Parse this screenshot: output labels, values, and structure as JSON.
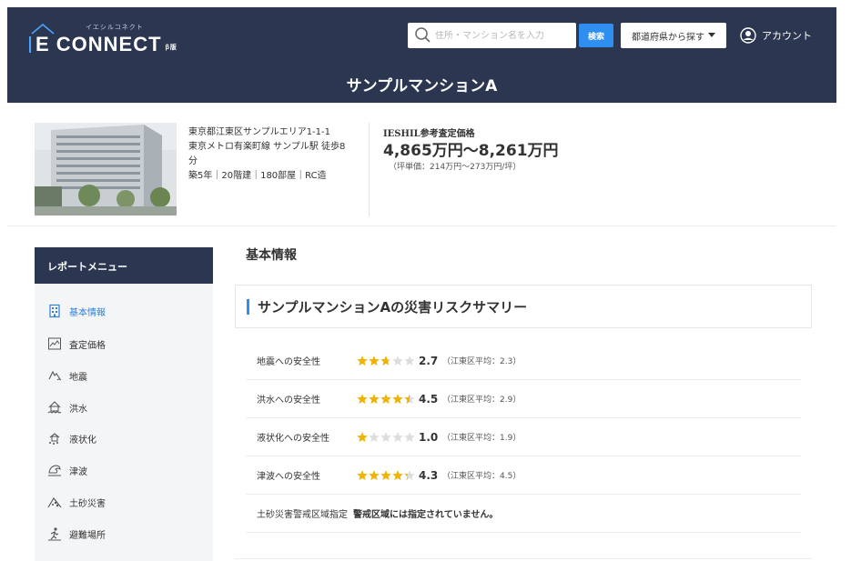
{
  "header": {
    "logo_kana": "イエシルコネクト",
    "logo_text": "E CONNECT",
    "logo_badge": "β版",
    "search_placeholder": "住所・マンション名を入力",
    "search_button": "検索",
    "prefecture_button": "都道府県から探す",
    "account_label": "アカウント",
    "property_title": "サンプルマンションA"
  },
  "summary": {
    "address_lines": [
      "東京都江東区サンプルエリア1-1-1",
      "東京メトロ有楽町線 サンプル駅 徒歩8分",
      "築5年｜20階建｜180部屋｜RC造"
    ],
    "price_label": "IESHIL参考査定価格",
    "price_range": "4,865万円〜8,261万円",
    "unit_price": "（坪単価：214万円〜273万円/坪）"
  },
  "sidebar": {
    "title": "レポートメニュー",
    "items": [
      {
        "label": "基本情報",
        "icon": "building-icon",
        "active": true
      },
      {
        "label": "査定価格",
        "icon": "chart-icon",
        "active": false
      },
      {
        "label": "地震",
        "icon": "earthquake-icon",
        "active": false
      },
      {
        "label": "洪水",
        "icon": "flood-icon",
        "active": false
      },
      {
        "label": "液状化",
        "icon": "liquefaction-icon",
        "active": false
      },
      {
        "label": "津波",
        "icon": "tsunami-icon",
        "active": false
      },
      {
        "label": "土砂災害",
        "icon": "landslide-icon",
        "active": false
      },
      {
        "label": "避難場所",
        "icon": "evacuation-icon",
        "active": false
      }
    ]
  },
  "main": {
    "section_title": "基本情報",
    "risk_title": "サンプルマンションAの災害リスクサマリー",
    "risks": [
      {
        "label": "地震への安全性",
        "rating": 2.7,
        "score": "2.7",
        "average": "（江東区平均：2.3）"
      },
      {
        "label": "洪水への安全性",
        "rating": 4.5,
        "score": "4.5",
        "average": "（江東区平均：2.9）"
      },
      {
        "label": "液状化への安全性",
        "rating": 1.0,
        "score": "1.0",
        "average": "（江東区平均：1.9）"
      },
      {
        "label": "津波への安全性",
        "rating": 4.3,
        "score": "4.3",
        "average": "（江東区平均：4.5）"
      }
    ],
    "landslide_label": "土砂災害警戒区域指定",
    "landslide_note": "警戒区域には指定されていません。"
  },
  "colors": {
    "navy": "#2b3650",
    "accent_blue": "#2f8ff0",
    "star_gold": "#f0b400",
    "star_empty": "#dddddd"
  }
}
